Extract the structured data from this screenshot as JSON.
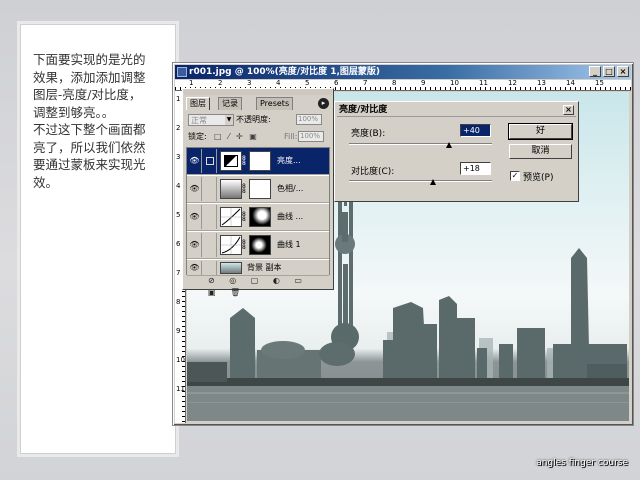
{
  "caption": {
    "paragraph1": "下面要实现的是光的效果，添加添加调整图层-亮度/对比度，调整到够亮。。",
    "paragraph2": "不过这下整个画面都亮了，所以我们依然要通过蒙板来实现光效。"
  },
  "document": {
    "title": "r001.jpg @ 100%(亮度/对比度 1,图层蒙版)",
    "window_buttons": [
      "_",
      "□",
      "×"
    ],
    "ruler_top": [
      "1",
      "2",
      "3",
      "4",
      "5",
      "6",
      "7",
      "8",
      "9",
      "10",
      "11",
      "12",
      "13",
      "14",
      "15"
    ],
    "ruler_left": [
      "1",
      "2",
      "3",
      "4",
      "5",
      "6",
      "7",
      "8",
      "9",
      "10",
      "11"
    ]
  },
  "layers_panel": {
    "tabs": [
      "图层",
      "记录",
      "Presets"
    ],
    "blend_mode": "正常",
    "opacity_label": "不透明度:",
    "opacity_value": "100%",
    "lock_label": "锁定:",
    "lock_icons": "□ ⁄ ✛ ▣",
    "fill_label": "Fill:",
    "fill_value": "100%",
    "layers": [
      {
        "name": "亮度...",
        "selected": true
      },
      {
        "name": "色相/...",
        "selected": false
      },
      {
        "name": "曲线 ...",
        "selected": false
      },
      {
        "name": "曲线 1",
        "selected": false
      },
      {
        "name": "背景 副本",
        "selected": false
      }
    ],
    "bottom_icons": "⊘ ◎ ▢ ◐ ▭ ▣ 🗑"
  },
  "bc_dialog": {
    "title": "亮度/对比度",
    "brightness_label": "亮度(B):",
    "brightness_value": "+40",
    "contrast_label": "对比度(C):",
    "contrast_value": "+18",
    "ok_label": "好",
    "cancel_label": "取消",
    "preview_label": "预览(P)",
    "preview_checked": "✓",
    "close": "×"
  },
  "credit": "angles finger course"
}
